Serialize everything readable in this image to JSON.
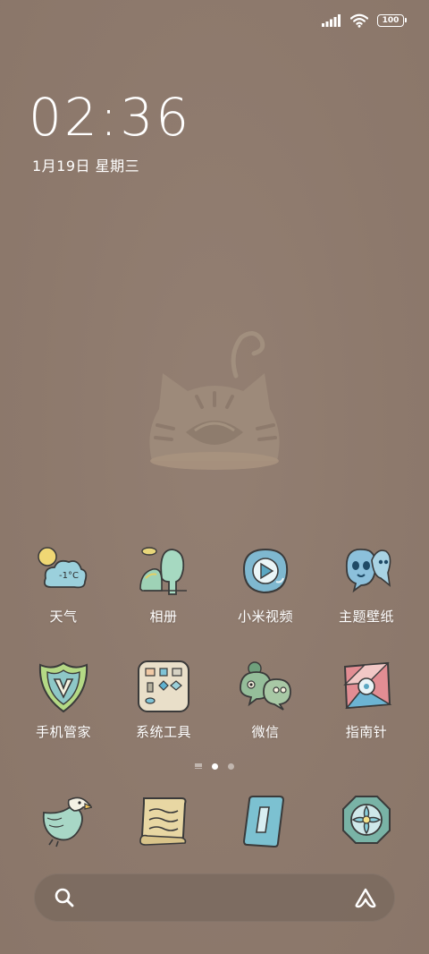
{
  "status_bar": {
    "battery_level": "100",
    "icons": [
      "signal-icon",
      "wifi-icon",
      "battery-icon"
    ]
  },
  "lock_clock": {
    "time": "02:36",
    "date": "1月19日 星期三"
  },
  "apps": [
    {
      "label": "天气",
      "icon": "weather-icon",
      "badge": "-1°C"
    },
    {
      "label": "相册",
      "icon": "gallery-icon"
    },
    {
      "label": "小米视频",
      "icon": "video-icon"
    },
    {
      "label": "主题壁纸",
      "icon": "themes-icon"
    },
    {
      "label": "手机管家",
      "icon": "security-icon"
    },
    {
      "label": "系统工具",
      "icon": "tools-icon"
    },
    {
      "label": "微信",
      "icon": "wechat-icon"
    },
    {
      "label": "指南针",
      "icon": "compass-icon"
    }
  ],
  "page_indicator": {
    "pages": 2,
    "current": 1
  },
  "dock": [
    {
      "icon": "eagle-phone-icon"
    },
    {
      "icon": "scroll-messages-icon"
    },
    {
      "icon": "browser-icon"
    },
    {
      "icon": "camera-icon"
    }
  ],
  "search": {
    "icons": [
      "search-icon",
      "assistant-icon"
    ]
  },
  "colors": {
    "background": "#8f7b6e",
    "foreground": "#ffffff"
  }
}
